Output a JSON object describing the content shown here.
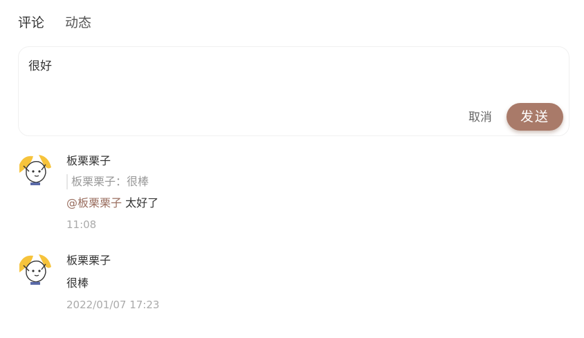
{
  "tabs": [
    "评论",
    "动态"
  ],
  "composer": {
    "text": "很好",
    "cancel_label": "取消",
    "send_label": "发送"
  },
  "colors": {
    "accent": "#a97a69",
    "mention": "#9a6e5f",
    "muted": "#aaaaaa"
  },
  "comments": [
    {
      "author": "板栗栗子",
      "quote": "板栗栗子：很棒",
      "mention": "@板栗栗子",
      "text": "太好了",
      "time": "11:08"
    },
    {
      "author": "板栗栗子",
      "text": "很棒",
      "time": "2022/01/07 17:23"
    }
  ]
}
